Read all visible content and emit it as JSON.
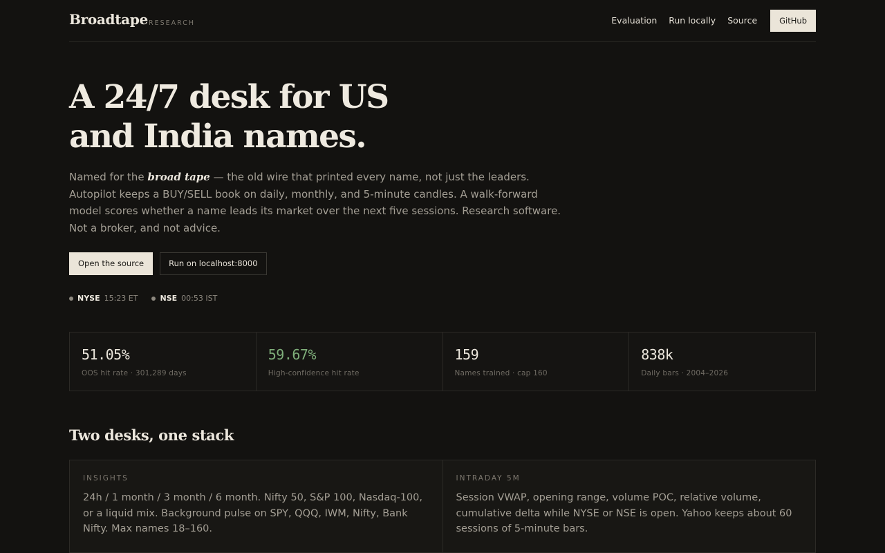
{
  "header": {
    "brand": "Broadtape",
    "brand_tag": "RESEARCH",
    "nav": [
      "Evaluation",
      "Run locally",
      "Source"
    ],
    "github_label": "GitHub"
  },
  "hero": {
    "title_line1": "A 24/7 desk for US",
    "title_line2": "and India names.",
    "lede_prefix": "Named for the ",
    "lede_emphasis": "broad tape",
    "lede_suffix": " — the old wire that printed every name, not just the leaders. Autopilot keeps a BUY/SELL book on daily, monthly, and 5-minute candles. A walk-forward model scores whether a name leads its market over the next five sessions. Research software. Not a broker, and not advice.",
    "primary_cta": "Open the source",
    "secondary_cta": "Run on localhost:8000"
  },
  "clocks": [
    {
      "exchange": "NYSE",
      "time": "15:23 ET"
    },
    {
      "exchange": "NSE",
      "time": "00:53 IST"
    }
  ],
  "stats": [
    {
      "value": "51.05%",
      "label": "OOS hit rate · 301,289 days"
    },
    {
      "value": "59.67%",
      "label": "High-confidence hit rate"
    },
    {
      "value": "159",
      "label": "Names trained · cap 160"
    },
    {
      "value": "838k",
      "label": "Daily bars · 2004–2026"
    }
  ],
  "colors": {
    "accent_green": "#7fae7a",
    "background": "#131210",
    "button_light": "#ebe5d9"
  },
  "section": {
    "title": "Two desks, one stack",
    "desks": [
      {
        "kicker": "INSIGHTS",
        "body": "24h / 1 month / 3 month / 6 month. Nifty 50, S&P 100, Nasdaq-100, or a liquid mix. Background pulse on SPY, QQQ, IWM, Nifty, Bank Nifty. Max names 18–160."
      },
      {
        "kicker": "INTRADAY 5M",
        "body": "Session VWAP, opening range, volume POC, relative volume, cumulative delta while NYSE or NSE is open. Yahoo keeps about 60 sessions of 5-minute bars."
      }
    ]
  }
}
